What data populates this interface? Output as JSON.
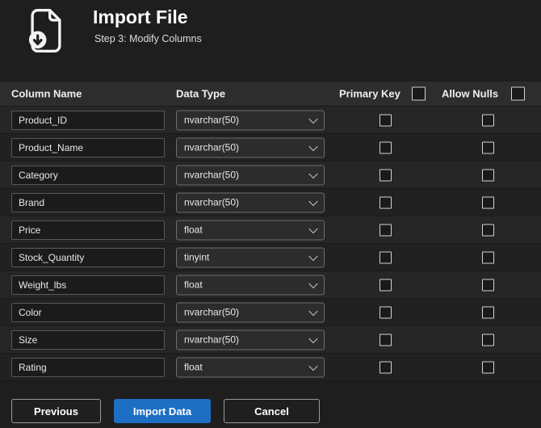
{
  "header": {
    "title": "Import File",
    "subtitle": "Step 3: Modify Columns"
  },
  "table": {
    "columns": {
      "name": "Column Name",
      "type": "Data Type",
      "primary_key": "Primary Key",
      "allow_nulls": "Allow Nulls"
    },
    "header_checkboxes": {
      "primary_key_checked": false,
      "allow_nulls_checked": false
    },
    "rows": [
      {
        "name": "Product_ID",
        "type": "nvarchar(50)",
        "primary_key": false,
        "allow_nulls": false
      },
      {
        "name": "Product_Name",
        "type": "nvarchar(50)",
        "primary_key": false,
        "allow_nulls": false
      },
      {
        "name": "Category",
        "type": "nvarchar(50)",
        "primary_key": false,
        "allow_nulls": false
      },
      {
        "name": "Brand",
        "type": "nvarchar(50)",
        "primary_key": false,
        "allow_nulls": false
      },
      {
        "name": "Price",
        "type": "float",
        "primary_key": false,
        "allow_nulls": false
      },
      {
        "name": "Stock_Quantity",
        "type": "tinyint",
        "primary_key": false,
        "allow_nulls": false
      },
      {
        "name": "Weight_lbs",
        "type": "float",
        "primary_key": false,
        "allow_nulls": false
      },
      {
        "name": "Color",
        "type": "nvarchar(50)",
        "primary_key": false,
        "allow_nulls": false
      },
      {
        "name": "Size",
        "type": "nvarchar(50)",
        "primary_key": false,
        "allow_nulls": false
      },
      {
        "name": "Rating",
        "type": "float",
        "primary_key": false,
        "allow_nulls": false
      }
    ]
  },
  "buttons": {
    "previous": "Previous",
    "import": "Import Data",
    "cancel": "Cancel"
  },
  "colors": {
    "accent": "#1d6fc4",
    "background": "#1e1e1e",
    "table_header": "#2d2d2d"
  }
}
